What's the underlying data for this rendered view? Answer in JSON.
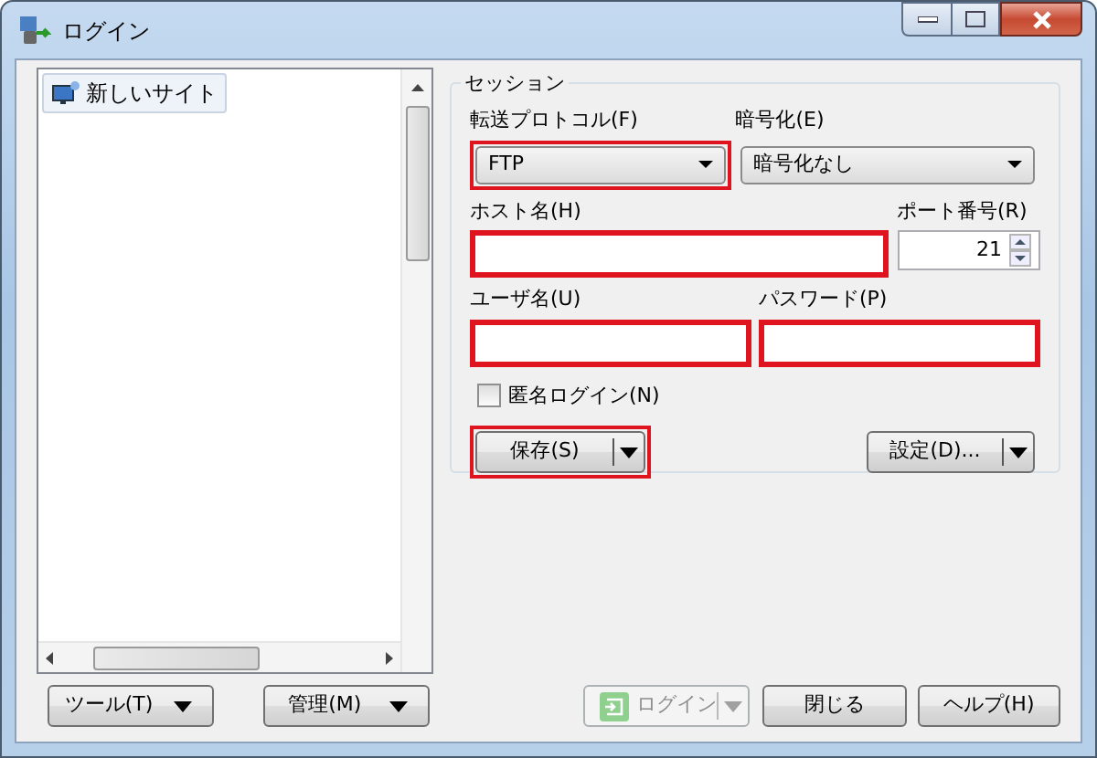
{
  "window": {
    "title": "ログイン"
  },
  "site_tree": {
    "items": [
      {
        "label": "新しいサイト",
        "selected": true
      }
    ]
  },
  "session": {
    "title": "セッション",
    "protocol": {
      "label": "転送プロトコル(F)",
      "value": "FTP",
      "highlighted": true
    },
    "encryption": {
      "label": "暗号化(E)",
      "value": "暗号化なし",
      "highlighted": false
    },
    "host": {
      "label": "ホスト名(H)",
      "highlighted": true
    },
    "port": {
      "label": "ポート番号(R)",
      "value": "21"
    },
    "user": {
      "label": "ユーザ名(U)",
      "highlighted": true
    },
    "password": {
      "label": "パスワード(P)",
      "highlighted": true
    },
    "anonymous": {
      "label": "匿名ログイン(N)",
      "checked": false
    },
    "save_button": {
      "label": "保存(S)",
      "highlighted": true
    },
    "settings_button": {
      "label": "設定(D)...",
      "highlighted": false
    }
  },
  "buttons": [
    {
      "label": "ツール(T)",
      "kind": "menu",
      "disabled": false
    },
    {
      "label": "管理(M)",
      "kind": "menu",
      "disabled": false
    },
    {
      "label": "ログイン",
      "kind": "split",
      "disabled": true
    },
    {
      "label": "閉じる",
      "kind": "plain",
      "disabled": false
    },
    {
      "label": "ヘルプ(H)",
      "kind": "plain",
      "disabled": false
    }
  ]
}
